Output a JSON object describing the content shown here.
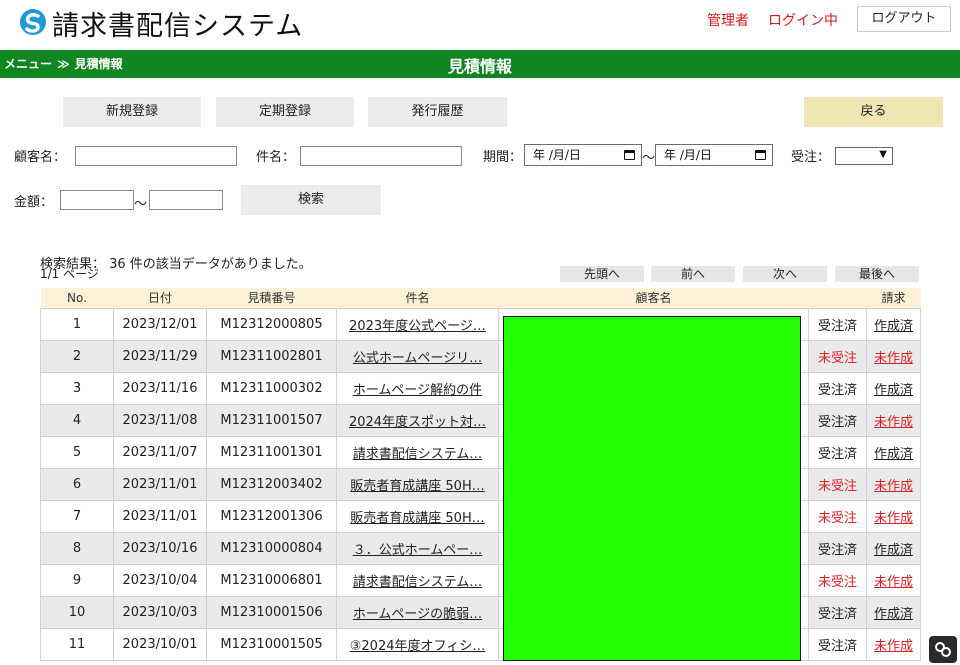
{
  "header": {
    "app_title": "請求書配信システム",
    "user_role": "管理者",
    "login_status": "ログイン中",
    "logout_label": "ログアウト"
  },
  "navbar": {
    "menu": "メニュー",
    "separator": "≫",
    "current": "見積情報",
    "title": "見積情報"
  },
  "actions": {
    "new_label": "新規登録",
    "recurring_label": "定期登録",
    "history_label": "発行履歴",
    "back_label": "戻る"
  },
  "search": {
    "customer_label": "顧客名：",
    "subject_label": "件名：",
    "period_label": "期間：",
    "date_from": "年 /月/日",
    "date_to": "年 /月/日",
    "range_sep": "〜",
    "order_label": "受注：",
    "amount_label": "金額：",
    "search_label": "検索"
  },
  "results": {
    "summary": "検索結果： 36 件の該当データがありました。",
    "page": "1/1 ページ"
  },
  "pagination": {
    "first": "先頭へ",
    "prev": "前へ",
    "next": "次へ",
    "last": "最後へ"
  },
  "table": {
    "headers": [
      "No.",
      "日付",
      "見積番号",
      "件名",
      "顧客名",
      "",
      "請求"
    ],
    "rows": [
      {
        "no": "1",
        "date": "2023/12/01",
        "estimate_no": "M12312000805",
        "subject": "2023年度公式ページ…",
        "order": "受注済",
        "invoice": "作成済"
      },
      {
        "no": "2",
        "date": "2023/11/29",
        "estimate_no": "M12311002801",
        "subject": "公式ホームページリ…",
        "order": "未受注",
        "invoice": "未作成"
      },
      {
        "no": "3",
        "date": "2023/11/16",
        "estimate_no": "M12311000302",
        "subject": "ホームページ解約の件",
        "order": "受注済",
        "invoice": "作成済"
      },
      {
        "no": "4",
        "date": "2023/11/08",
        "estimate_no": "M12311001507",
        "subject": "2024年度スポット対…",
        "order": "受注済",
        "invoice": "未作成"
      },
      {
        "no": "5",
        "date": "2023/11/07",
        "estimate_no": "M12311001301",
        "subject": "請求書配信システム…",
        "order": "受注済",
        "invoice": "作成済"
      },
      {
        "no": "6",
        "date": "2023/11/01",
        "estimate_no": "M12312003402",
        "subject": "販売者育成講座 50H…",
        "order": "未受注",
        "invoice": "未作成"
      },
      {
        "no": "7",
        "date": "2023/11/01",
        "estimate_no": "M12312001306",
        "subject": "販売者育成講座 50H…",
        "order": "未受注",
        "invoice": "未作成"
      },
      {
        "no": "8",
        "date": "2023/10/16",
        "estimate_no": "M12310000804",
        "subject": "３．公式ホームペー…",
        "order": "受注済",
        "invoice": "作成済"
      },
      {
        "no": "9",
        "date": "2023/10/04",
        "estimate_no": "M12310006801",
        "subject": "請求書配信システム…",
        "order": "未受注",
        "invoice": "未作成"
      },
      {
        "no": "10",
        "date": "2023/10/03",
        "estimate_no": "M12310001506",
        "subject": "ホームページの脆弱…",
        "order": "受注済",
        "invoice": "作成済"
      },
      {
        "no": "11",
        "date": "2023/10/01",
        "estimate_no": "M12310001505",
        "subject": "③2024年度オフィシ…",
        "order": "受注済",
        "invoice": "未作成"
      }
    ]
  },
  "colors": {
    "nav_green": "#11851f",
    "alert_red": "#e02020",
    "back_button": "#efe6b4",
    "header_row": "#fdf1d8",
    "redaction": "#22ff00"
  }
}
